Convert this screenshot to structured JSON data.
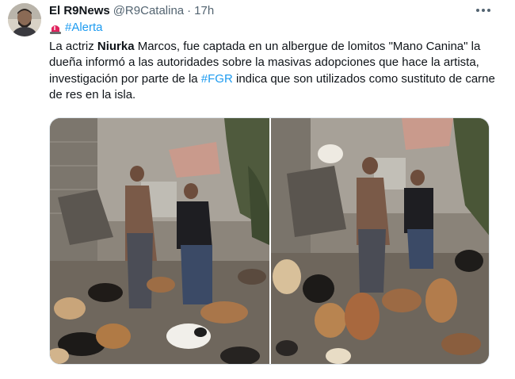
{
  "tweet": {
    "author_name": "El R9News",
    "author_handle": "@R9Catalina",
    "separator": "·",
    "time": "17h",
    "tag": "#Alerta",
    "text": {
      "t1": "La actriz ",
      "t2": "Niurka",
      "t3": " Marcos, fue captada en un albergue de lomitos \"Mano Canina\" la dueña informó a las autoridades sobre la masivas adopciones que hace la artista, investigación por parte de la ",
      "t4": "#FGR",
      "t5": "  indica que son utilizados como sustituto de carne de res en la isla."
    }
  },
  "icons": {
    "more": "more-horizontal-icon",
    "siren": "rotating-light-icon"
  },
  "colors": {
    "link": "#1d9bf0",
    "secondary_text": "#536471",
    "primary_text": "#0f1419"
  }
}
